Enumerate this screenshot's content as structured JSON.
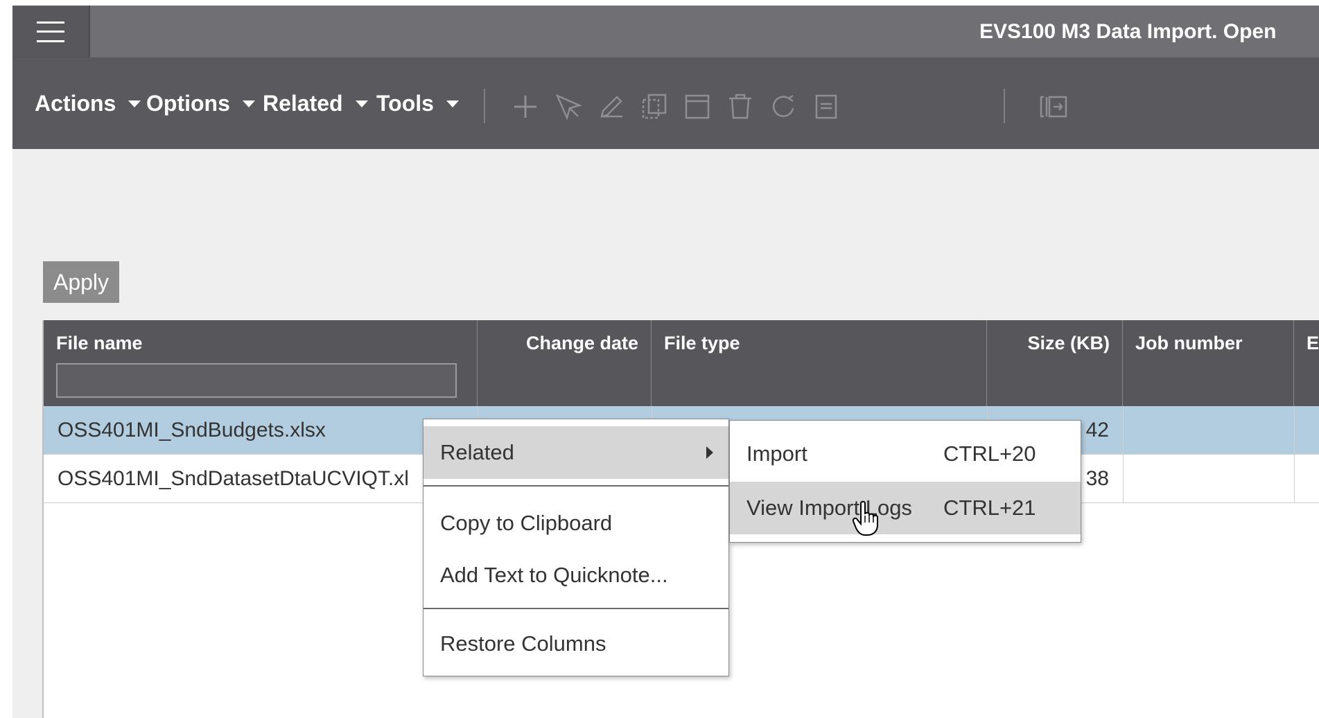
{
  "window": {
    "title": "EVS100 M3 Data Import. Open"
  },
  "toolbar": {
    "menus": [
      {
        "label": "Actions"
      },
      {
        "label": "Options"
      },
      {
        "label": "Related"
      },
      {
        "label": "Tools"
      }
    ],
    "icons": [
      "plus-icon",
      "select-arrow-icon",
      "pencil-icon",
      "copy-icon",
      "panel-icon",
      "trash-icon",
      "refresh-icon",
      "notes-icon",
      "expand-panel-icon"
    ]
  },
  "filters": {
    "apply_label": "Apply",
    "file_name_value": ""
  },
  "table": {
    "columns": [
      {
        "label": "File name"
      },
      {
        "label": "Change date"
      },
      {
        "label": "File type"
      },
      {
        "label": "Size (KB)"
      },
      {
        "label": "Job number"
      },
      {
        "label": "Ex"
      }
    ],
    "rows": [
      {
        "file_name": "OSS401MI_SndBudgets.xlsx",
        "change_date": "",
        "file_type": "",
        "size_kb": "42",
        "job_number": "",
        "selected": true
      },
      {
        "file_name": "OSS401MI_SndDatasetDtaUCVIQT.xl",
        "change_date": "",
        "file_type": "",
        "size_kb": "38",
        "job_number": "",
        "selected": false
      }
    ]
  },
  "context_menu": {
    "items": [
      {
        "label": "Related",
        "has_submenu": true
      },
      {
        "label": "Copy to Clipboard"
      },
      {
        "label": "Add Text to Quicknote..."
      },
      {
        "label": "Restore Columns"
      }
    ],
    "submenu": [
      {
        "label": "Import",
        "shortcut": "CTRL+20"
      },
      {
        "label": "View Import Logs",
        "shortcut": "CTRL+21"
      }
    ]
  }
}
